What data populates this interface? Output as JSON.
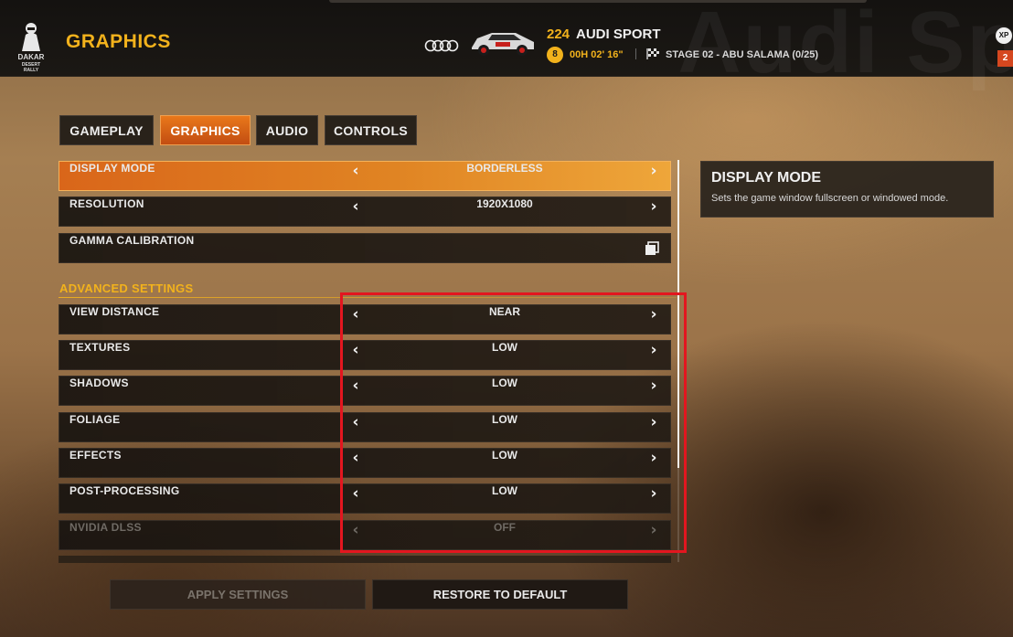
{
  "header": {
    "logo_text": "DAKAR",
    "logo_subtext": "DESERT RALLY",
    "title": "GRAPHICS",
    "car_number": "224",
    "car_team": "AUDI SPORT",
    "timer": "00H 02' 16\"",
    "timer_icon_text": "8",
    "stage": "STAGE 02 - ABU SALAMA (0/25)",
    "watermark": "Audi Sp",
    "xp_label": "XP",
    "level": "2"
  },
  "tabs": [
    {
      "label": "GAMEPLAY",
      "active": false
    },
    {
      "label": "GRAPHICS",
      "active": true
    },
    {
      "label": "AUDIO",
      "active": false
    },
    {
      "label": "CONTROLS",
      "active": false
    }
  ],
  "settings": [
    {
      "label": "DISPLAY MODE",
      "value": "BORDERLESS",
      "active": true
    },
    {
      "label": "RESOLUTION",
      "value": "1920X1080"
    },
    {
      "label": "GAMMA CALIBRATION",
      "icon": "open-window-icon"
    }
  ],
  "advanced": {
    "title": "ADVANCED SETTINGS",
    "rows": [
      {
        "label": "VIEW DISTANCE",
        "value": "NEAR"
      },
      {
        "label": "TEXTURES",
        "value": "LOW"
      },
      {
        "label": "SHADOWS",
        "value": "LOW"
      },
      {
        "label": "FOLIAGE",
        "value": "LOW"
      },
      {
        "label": "EFFECTS",
        "value": "LOW"
      },
      {
        "label": "POST-PROCESSING",
        "value": "LOW"
      },
      {
        "label": "NVIDIA DLSS",
        "value": "OFF",
        "disabled": true
      }
    ]
  },
  "arrows": {
    "left": "‹",
    "right": "›"
  },
  "info": {
    "title": "DISPLAY MODE",
    "description": "Sets the game window fullscreen or windowed mode."
  },
  "buttons": {
    "apply": "APPLY SETTINGS",
    "restore": "RESTORE TO DEFAULT"
  },
  "colors": {
    "accent": "#f2b21c",
    "active_tab": "#e9781a",
    "highlight_box": "#e3161f"
  }
}
